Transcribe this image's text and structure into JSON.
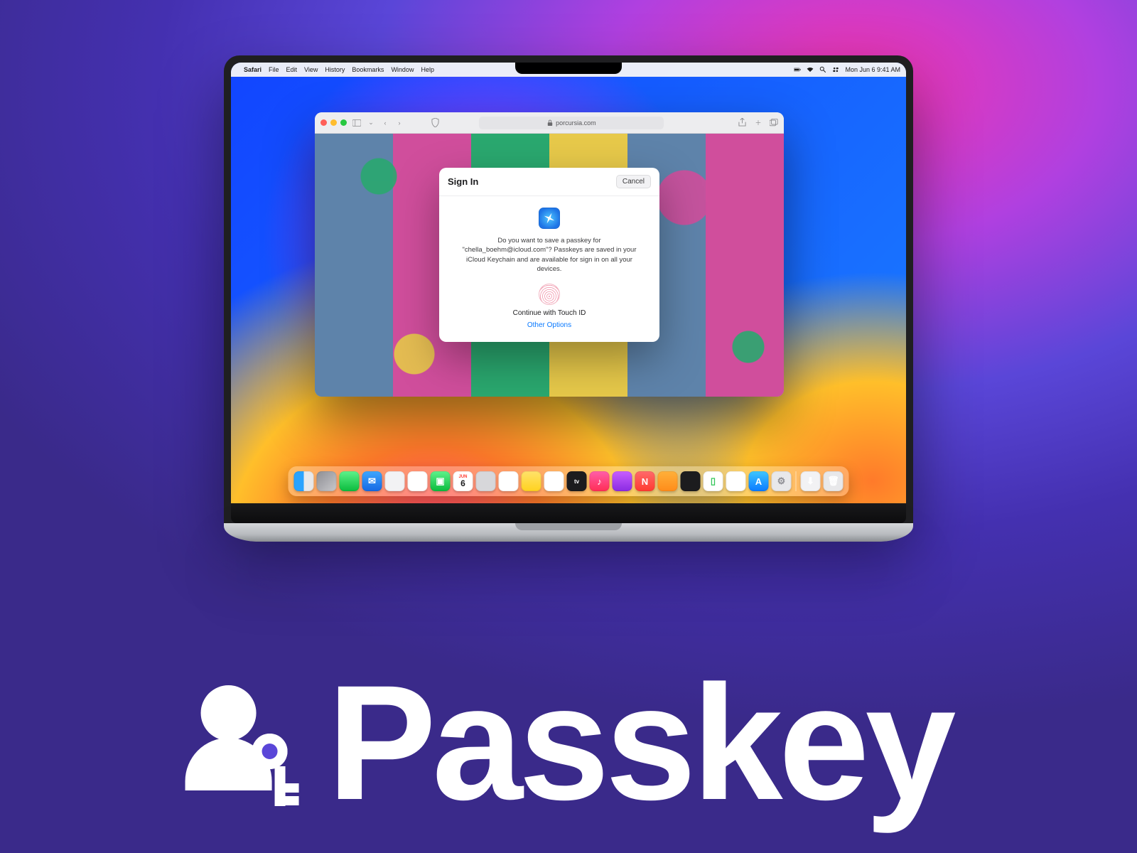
{
  "hero": {
    "title": "Passkey"
  },
  "menubar": {
    "app": "Safari",
    "items": [
      "File",
      "Edit",
      "View",
      "History",
      "Bookmarks",
      "Window",
      "Help"
    ],
    "clock": "Mon Jun 6  9:41 AM"
  },
  "safari": {
    "address": "porcursia.com"
  },
  "dialog": {
    "title": "Sign In",
    "cancel": "Cancel",
    "message": "Do you want to save a passkey for \"chella_boehm@icloud.com\"? Passkeys are saved in your iCloud Keychain and are available for sign in on all your devices.",
    "cta": "Continue with Touch ID",
    "other": "Other Options"
  },
  "dock": {
    "cal_label": "JUN",
    "cal_day": "6",
    "tv_label": "tv"
  }
}
